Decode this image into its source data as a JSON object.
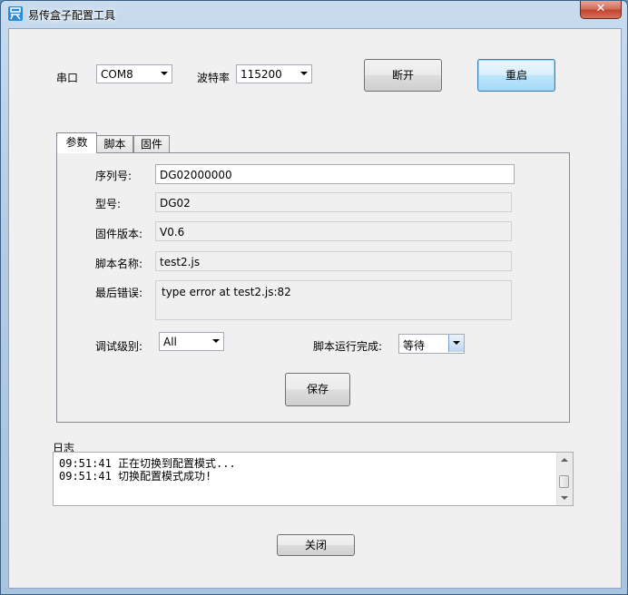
{
  "window": {
    "title": "易传盒子配置工具",
    "close_glyph": "✕",
    "icon": "app-logo-icon"
  },
  "top": {
    "port_label": "串口",
    "port_value": "COM8",
    "baud_label": "波特率",
    "baud_value": "115200",
    "disconnect_label": "断开",
    "restart_label": "重启"
  },
  "tabs": [
    {
      "label": "参数"
    },
    {
      "label": "脚本"
    },
    {
      "label": "固件"
    }
  ],
  "params": {
    "serial_label": "序列号:",
    "serial_value": "DG02000000",
    "model_label": "型号:",
    "model_value": "DG02",
    "fw_label": "固件版本:",
    "fw_value": "V0.6",
    "script_label": "脚本名称:",
    "script_value": "test2.js",
    "err_label": "最后错误:",
    "err_value": "type error  at test2.js:82",
    "debug_label": "调试级别:",
    "debug_value": "All",
    "done_label": "脚本运行完成:",
    "done_value": "等待",
    "save_label": "保存"
  },
  "log": {
    "label": "日志",
    "lines": [
      "09:51:41  正在切换到配置模式...",
      "09:51:41  切换配置模式成功!"
    ]
  },
  "footer": {
    "close_label": "关闭"
  }
}
